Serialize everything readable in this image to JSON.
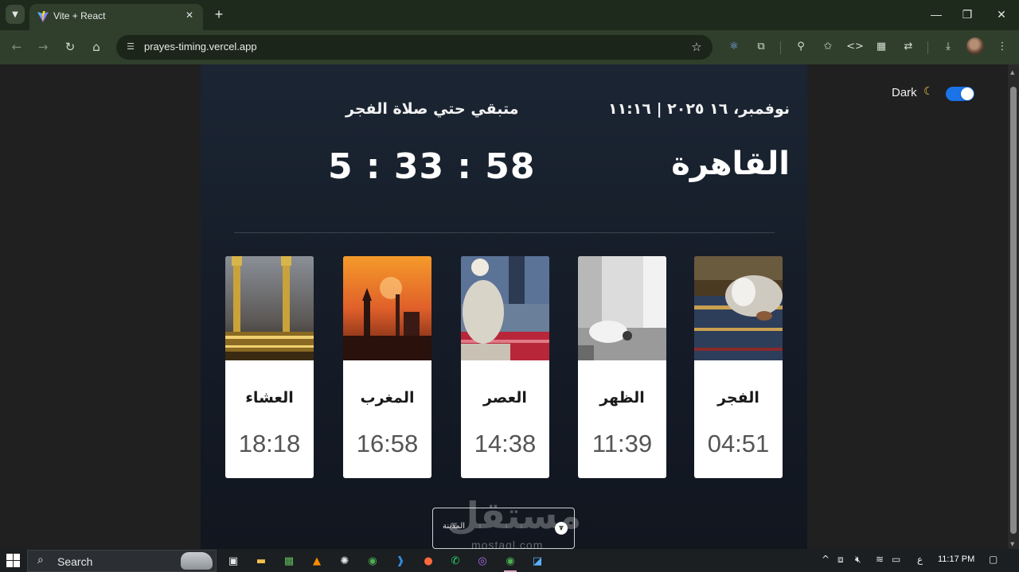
{
  "browser": {
    "tab_title": "Vite + React",
    "url": "prayes-timing.vercel.app"
  },
  "page": {
    "theme_toggle_label": "Dark",
    "theme_toggle_on": true,
    "date_line": "نوفمبر، ١٦ ٢٠٢٥ | ١١:١٦",
    "city": "القاهرة",
    "remaining_label": "متبقي حتي صلاة الفجر",
    "countdown": "5 : 33 : 58",
    "prayers": [
      {
        "name": "العشاء",
        "time": "18:18",
        "image": "kaaba-night-photo"
      },
      {
        "name": "المغرب",
        "time": "16:58",
        "image": "minaret-sunset-photo"
      },
      {
        "name": "العصر",
        "time": "14:38",
        "image": "man-sitting-in-mosque-photo"
      },
      {
        "name": "الظهر",
        "time": "11:39",
        "image": "man-prostrating-photo"
      },
      {
        "name": "الفجر",
        "time": "04:51",
        "image": "man-praying-on-carpet-photo"
      }
    ],
    "city_select_label": "المدينة",
    "watermark": "مستقل",
    "watermark_sub": "mostaql.com"
  },
  "taskbar": {
    "search_placeholder": "Search",
    "clock": "11:17 PM",
    "input_indicator": "ع"
  },
  "colors": {
    "accent": "#1a73e8",
    "panel_top": "#1b2533",
    "panel_bottom": "#11161f",
    "card_bg": "#ffffff"
  }
}
